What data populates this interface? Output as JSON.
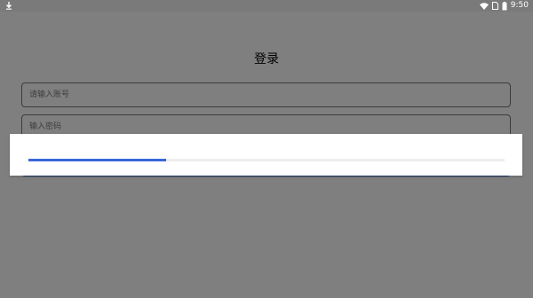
{
  "status_bar": {
    "time": "9:50",
    "left_icon": "download-icon",
    "right_icons": [
      "wifi-icon",
      "sim-icon",
      "battery-icon"
    ]
  },
  "login": {
    "title": "登录",
    "account_placeholder": "请输入账号",
    "password_placeholder": "输入密码"
  },
  "progress": {
    "value": 0.29
  },
  "colors": {
    "accent": "#2f66d6",
    "scrim": "rgba(0,0,0,0.5)"
  }
}
